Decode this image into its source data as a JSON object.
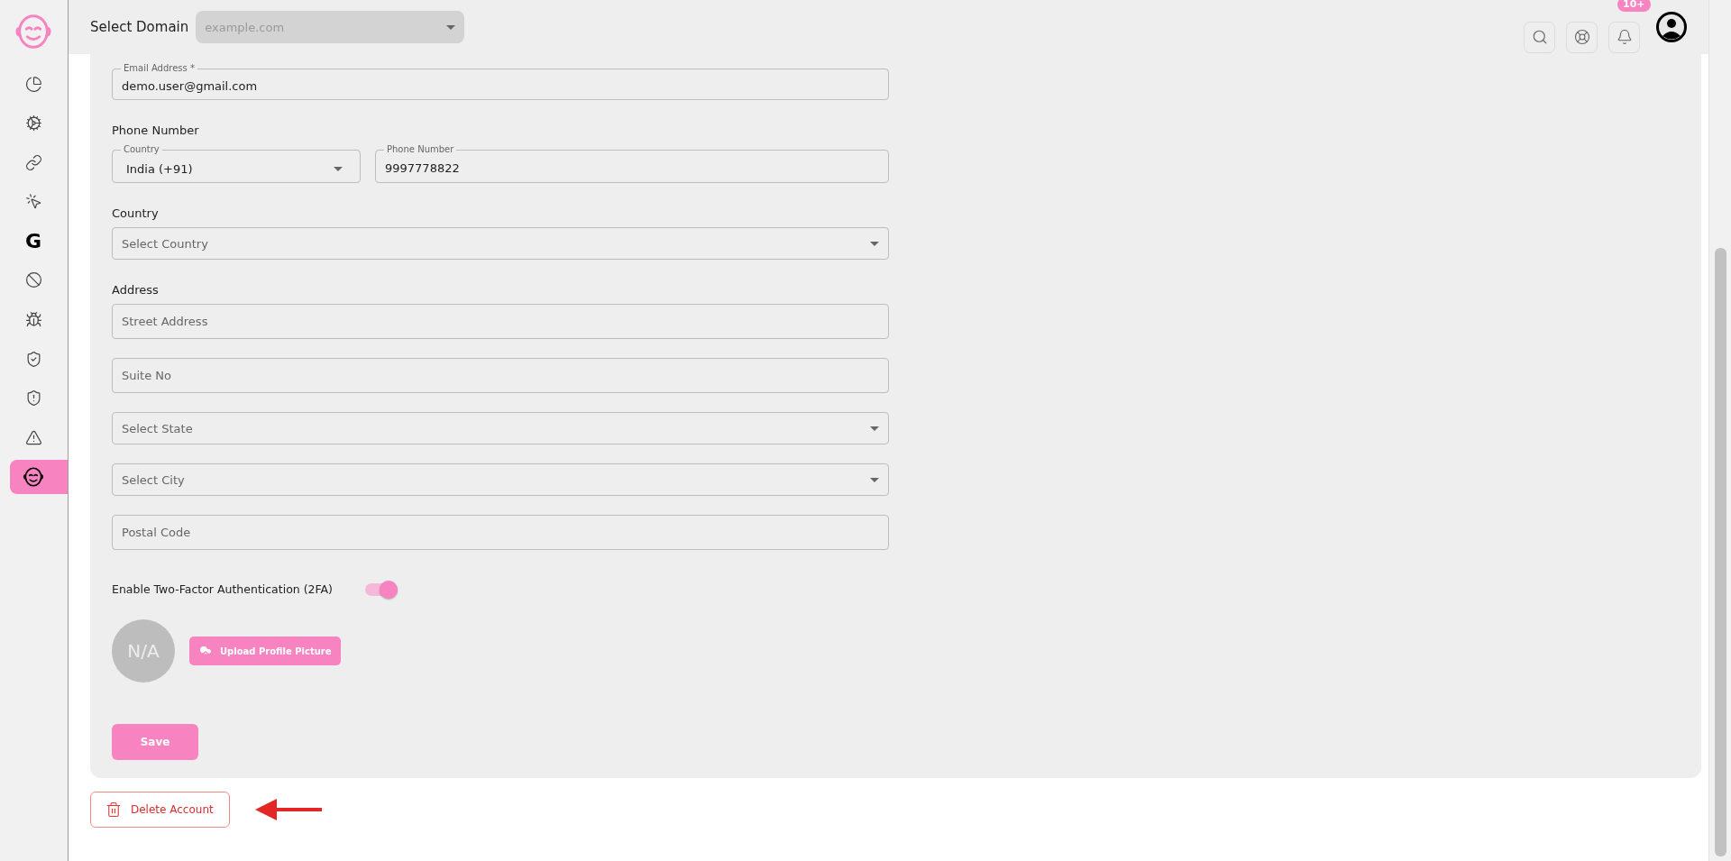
{
  "sidebar": {
    "items": [
      {
        "kind": "icon",
        "selected": false
      },
      {
        "kind": "icon",
        "selected": false
      },
      {
        "kind": "icon",
        "selected": false
      },
      {
        "kind": "icon",
        "selected": false
      },
      {
        "kind": "letter",
        "label": "G",
        "selected": false
      },
      {
        "kind": "icon",
        "selected": false
      },
      {
        "kind": "icon",
        "selected": false
      },
      {
        "kind": "icon",
        "selected": false
      },
      {
        "kind": "icon",
        "selected": false
      },
      {
        "kind": "icon",
        "selected": false
      },
      {
        "kind": "icon",
        "selected": true
      }
    ]
  },
  "top_bar": {
    "domain_label": "Select Domain",
    "domain_select": {
      "placeholder": "example.com",
      "disabled": true
    },
    "notification_badge": "10+"
  },
  "form": {
    "email": {
      "label": "Email Address *",
      "value": "demo.user@gmail.com"
    },
    "phone": {
      "heading": "Phone Number",
      "country": {
        "label": "Country",
        "value": "India (+91)"
      },
      "number": {
        "label": "Phone Number",
        "value": "9997778822"
      }
    },
    "country": {
      "heading": "Country",
      "placeholder": "Select Country"
    },
    "address": {
      "heading": "Address",
      "fields": [
        {
          "kind": "input",
          "placeholder": "Street Address"
        },
        {
          "kind": "input",
          "placeholder": "Suite No"
        },
        {
          "kind": "select",
          "placeholder": "Select State"
        },
        {
          "kind": "select",
          "placeholder": "Select City"
        },
        {
          "kind": "input",
          "placeholder": "Postal Code"
        }
      ]
    },
    "two_factor": {
      "label": "Enable Two-Factor Authentication (2FA)",
      "on": true
    },
    "avatar": {
      "initials": "N/A"
    },
    "upload_button": "Upload Profile Picture",
    "save_button": "Save"
  },
  "delete_button": "Delete Account"
}
